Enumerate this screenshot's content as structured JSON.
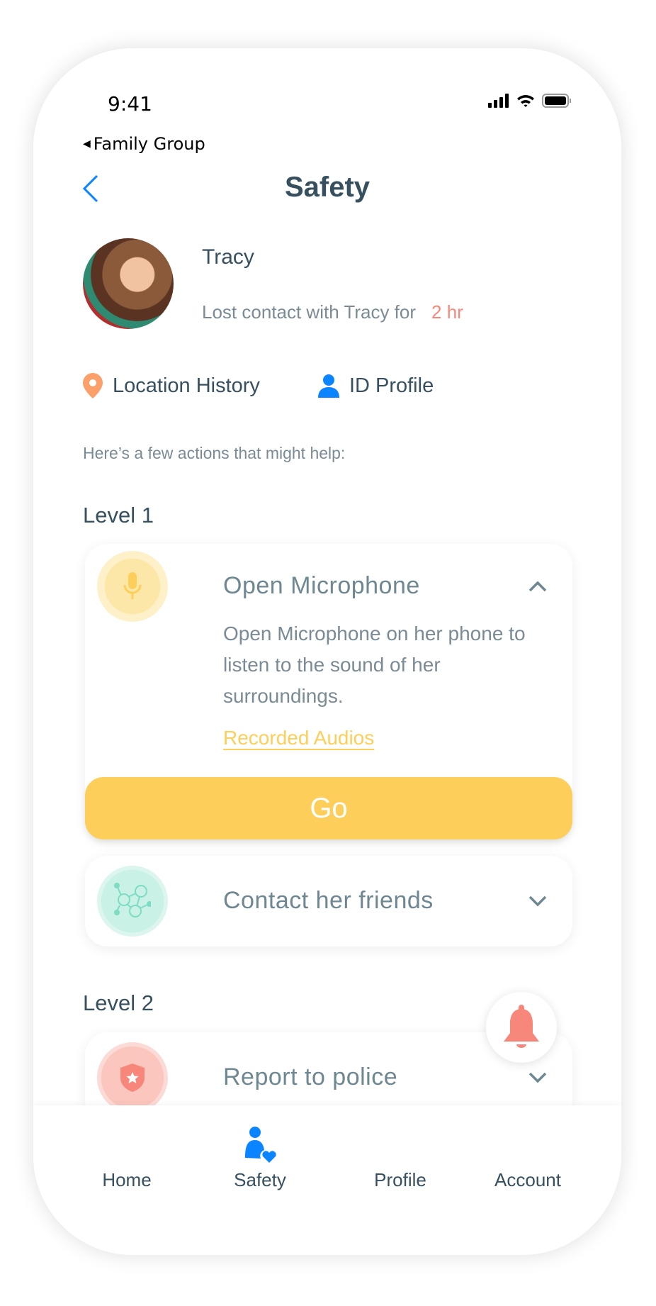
{
  "status_bar": {
    "time": "9:41",
    "icons": [
      "signal-icon",
      "wifi-icon",
      "battery-icon"
    ]
  },
  "nav": {
    "breadcrumb": "Family Group",
    "title": "Safety"
  },
  "person": {
    "name": "Tracy",
    "lost_contact_text": "Lost contact with Tracy for",
    "lost_duration": "2 hr"
  },
  "links": [
    {
      "label": "Location History",
      "icon": "location-pin-icon"
    },
    {
      "label": "ID Profile",
      "icon": "person-icon"
    }
  ],
  "hint": "Here’s a few actions that might help:",
  "levels": [
    {
      "label": "Level 1",
      "actions": [
        {
          "title": "Open Microphone",
          "icon": "microphone-icon",
          "expanded": true,
          "description": "Open Microphone on her phone to listen to the sound of her surroundings.",
          "link": "Recorded Audios",
          "button": "Go"
        },
        {
          "title": "Contact her friends",
          "icon": "friends-network-icon",
          "expanded": false
        }
      ]
    },
    {
      "label": "Level 2",
      "actions": [
        {
          "title": "Report to police",
          "icon": "police-badge-icon",
          "expanded": false
        }
      ]
    }
  ],
  "tabs": [
    {
      "label": "Home"
    },
    {
      "label": "Safety",
      "active": true
    },
    {
      "label": "Profile"
    },
    {
      "label": "Account"
    }
  ],
  "colors": {
    "accent_blue": "#0a84ff",
    "yellow": "#fdcf5a",
    "coral": "#f7877a",
    "mint": "#7ddcc4",
    "text_dark": "#37505f",
    "text_gray": "#7a8b95"
  }
}
